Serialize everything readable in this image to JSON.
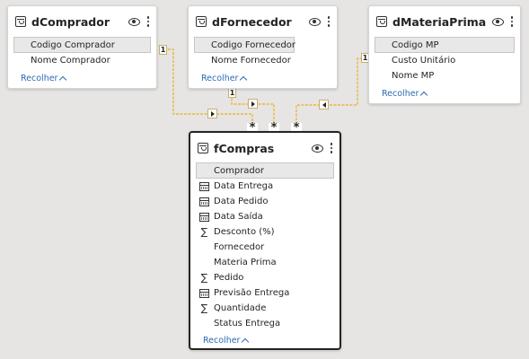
{
  "tables": {
    "dComprador": {
      "title": "dComprador",
      "fields": [
        "Codigo Comprador",
        "Nome Comprador"
      ],
      "collapse_label": "Recolher"
    },
    "dFornecedor": {
      "title": "dFornecedor",
      "fields": [
        "Codigo Fornecedor",
        "Nome Fornecedor"
      ],
      "collapse_label": "Recolher"
    },
    "dMateriaPrima": {
      "title": "dMateriaPrima",
      "fields": [
        "Codigo MP",
        "Custo Unitário",
        "Nome MP"
      ],
      "collapse_label": "Recolher"
    },
    "fCompras": {
      "title": "fCompras",
      "fields": [
        {
          "name": "Comprador",
          "icon": ""
        },
        {
          "name": "Data Entrega",
          "icon": "calendar-icon"
        },
        {
          "name": "Data Pedido",
          "icon": "calendar-icon"
        },
        {
          "name": "Data Saída",
          "icon": "calendar-icon"
        },
        {
          "name": "Desconto (%)",
          "icon": "sigma-icon"
        },
        {
          "name": "Fornecedor",
          "icon": ""
        },
        {
          "name": "Materia Prima",
          "icon": ""
        },
        {
          "name": "Pedido",
          "icon": "sigma-icon"
        },
        {
          "name": "Previsão Entrega",
          "icon": "calendar-icon"
        },
        {
          "name": "Quantidade",
          "icon": "sigma-icon"
        },
        {
          "name": "Status Entrega",
          "icon": ""
        }
      ],
      "collapse_label": "Recolher"
    }
  },
  "relationships": {
    "one_label": "1",
    "many_label": "*"
  },
  "colors": {
    "relationship_line": "#e8b83a",
    "link": "#2b6cb3",
    "canvas": "#e6e5e4"
  }
}
